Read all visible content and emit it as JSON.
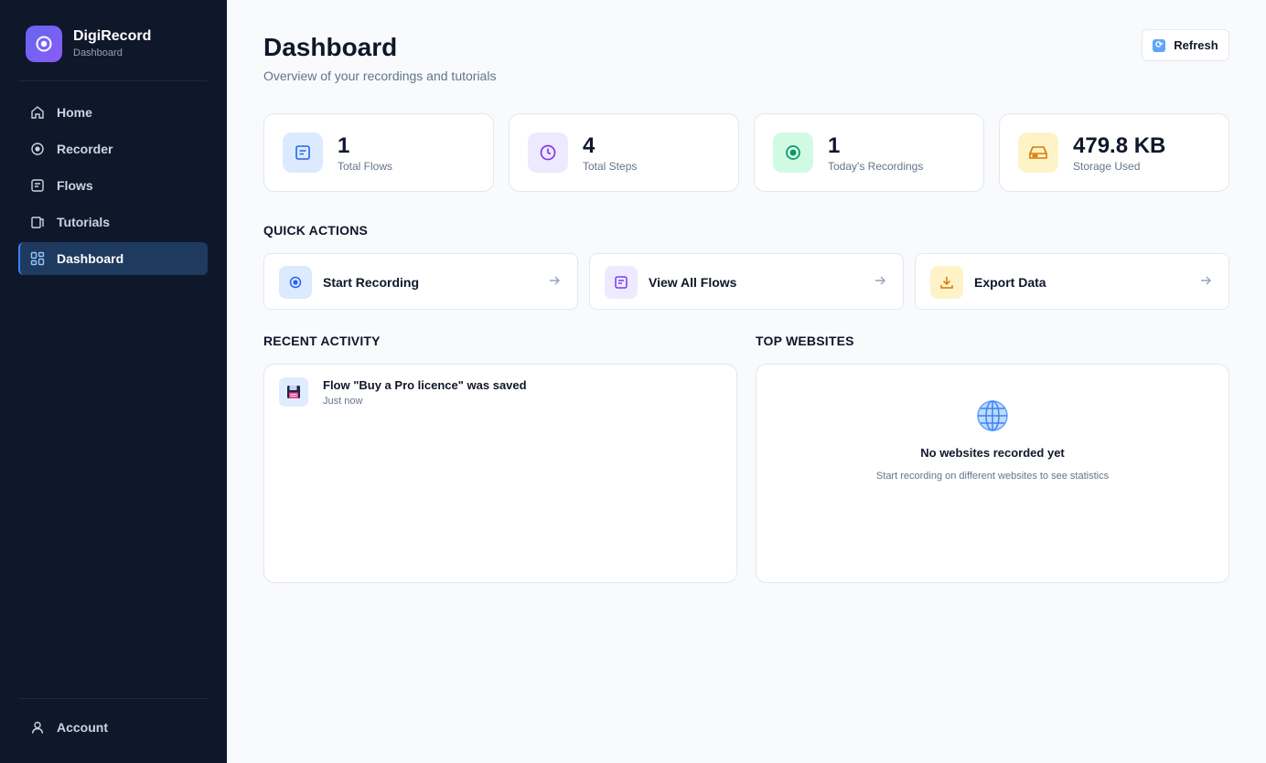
{
  "brand": {
    "name": "DigiRecord",
    "subtitle": "Dashboard"
  },
  "nav": {
    "items": [
      {
        "label": "Home",
        "icon": "home-icon"
      },
      {
        "label": "Recorder",
        "icon": "record-icon"
      },
      {
        "label": "Flows",
        "icon": "list-icon"
      },
      {
        "label": "Tutorials",
        "icon": "book-icon"
      },
      {
        "label": "Dashboard",
        "icon": "grid-icon",
        "active": true
      }
    ],
    "account": {
      "label": "Account",
      "icon": "user-icon"
    }
  },
  "header": {
    "title": "Dashboard",
    "subtitle": "Overview of your recordings and tutorials",
    "refresh_label": "Refresh"
  },
  "stats": [
    {
      "value": "1",
      "label": "Total Flows",
      "icon": "document-icon",
      "color": "#dbeafe"
    },
    {
      "value": "4",
      "label": "Total Steps",
      "icon": "clock-icon",
      "color": "#ede9fe"
    },
    {
      "value": "1",
      "label": "Today's Recordings",
      "icon": "record-icon",
      "color": "#d1fae5"
    },
    {
      "value": "479.8 KB",
      "label": "Storage Used",
      "icon": "hard-drive-icon",
      "color": "#fef3c7"
    }
  ],
  "quick_actions": {
    "title": "QUICK ACTIONS",
    "items": [
      {
        "label": "Start Recording",
        "icon": "record-icon",
        "color": "#dbeafe"
      },
      {
        "label": "View All Flows",
        "icon": "list-icon",
        "color": "#ede9fe"
      },
      {
        "label": "Export Data",
        "icon": "download-icon",
        "color": "#fef3c7"
      }
    ]
  },
  "recent_activity": {
    "title": "RECENT ACTIVITY",
    "items": [
      {
        "title": "Flow \"Buy a Pro licence\" was saved",
        "time": "Just now",
        "icon": "floppy-disk-icon"
      }
    ]
  },
  "top_websites": {
    "title": "TOP WEBSITES",
    "empty_title": "No websites recorded yet",
    "empty_subtitle": "Start recording on different websites to see statistics",
    "icon": "globe-icon"
  },
  "colors": {
    "sidebar_bg": "#0f172a",
    "active_nav": "#1e3a5f",
    "accent": "#3b82f6"
  }
}
